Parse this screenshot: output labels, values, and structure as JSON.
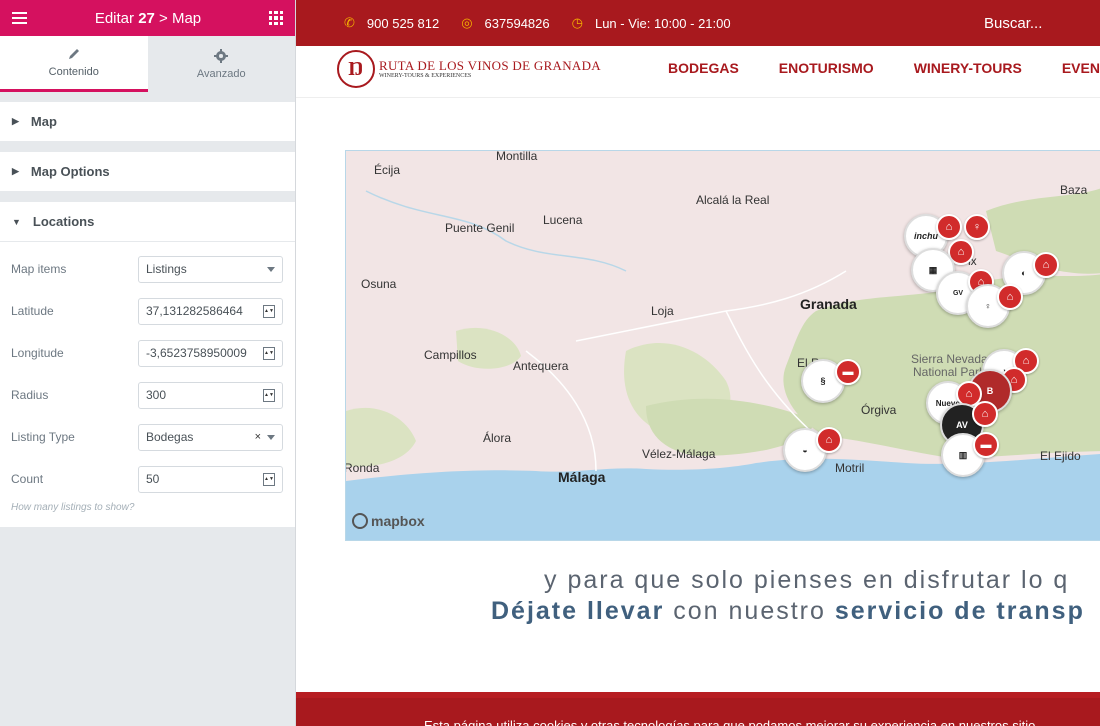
{
  "editor": {
    "title_prefix": "Editar",
    "title_number": "27",
    "title_suffix": "> Map",
    "tabs": [
      {
        "label": "Contenido",
        "icon": "pencil-icon"
      },
      {
        "label": "Avanzado",
        "icon": "gear-icon"
      }
    ],
    "sections": {
      "map": "Map",
      "map_options": "Map Options",
      "locations": "Locations"
    },
    "fields": {
      "map_items": {
        "label": "Map items",
        "value": "Listings"
      },
      "latitude": {
        "label": "Latitude",
        "value": "37,131282586464"
      },
      "longitude": {
        "label": "Longitude",
        "value": "-3,6523758950009"
      },
      "radius": {
        "label": "Radius",
        "value": "300"
      },
      "listing_type": {
        "label": "Listing Type",
        "value": "Bodegas"
      },
      "count": {
        "label": "Count",
        "value": "50"
      }
    },
    "hint": "How many listings to show?"
  },
  "site": {
    "topbar": {
      "phone": "900 525 812",
      "whatsapp": "637594826",
      "hours": "Lun - Vie: 10:00 - 21:00",
      "search": "Buscar..."
    },
    "logo": {
      "line1": "RUTA DE LOS VINOS DE GRANADA",
      "line2": "WINERY-TOURS & EXPERIENCES"
    },
    "nav": [
      "BODEGAS",
      "ENOTURISMO",
      "WINERY-TOURS",
      "EVEN"
    ],
    "map": {
      "places": [
        {
          "name": "Montilla"
        },
        {
          "name": "Écija"
        },
        {
          "name": "Alcalá la Real"
        },
        {
          "name": "Baza"
        },
        {
          "name": "Puente Genil"
        },
        {
          "name": "Lucena"
        },
        {
          "name": "Osuna"
        },
        {
          "name": "Granada"
        },
        {
          "name": "Loja"
        },
        {
          "name": "Campillos"
        },
        {
          "name": "Antequera"
        },
        {
          "name": "Sierra Nevada"
        },
        {
          "name": "National Park"
        },
        {
          "name": "Órgiva"
        },
        {
          "name": "Álora"
        },
        {
          "name": "Vélez-Málaga"
        },
        {
          "name": "Motril"
        },
        {
          "name": "El Ejido"
        },
        {
          "name": "Ronda"
        },
        {
          "name": "Málaga"
        },
        {
          "name": "El R"
        },
        {
          "name": "ix"
        }
      ],
      "attribution": "mapbox"
    },
    "tagline": {
      "line1": "y para que solo pienses en disfrutar lo q",
      "line2_bold1": "Déjate llevar",
      "line2_mid": " con nuestro ",
      "line2_bold2": "servicio de transp"
    },
    "footer_text": "Esta página utiliza cookies y otras tecnologías para que podamos mejorar su experiencia en nuestros sitio"
  },
  "colors": {
    "editor_accent": "#d5115f",
    "site_red": "#a8191e",
    "badge_red": "#d12b2b",
    "sea": "#a9d2ec",
    "green": "#cfdcb4"
  }
}
